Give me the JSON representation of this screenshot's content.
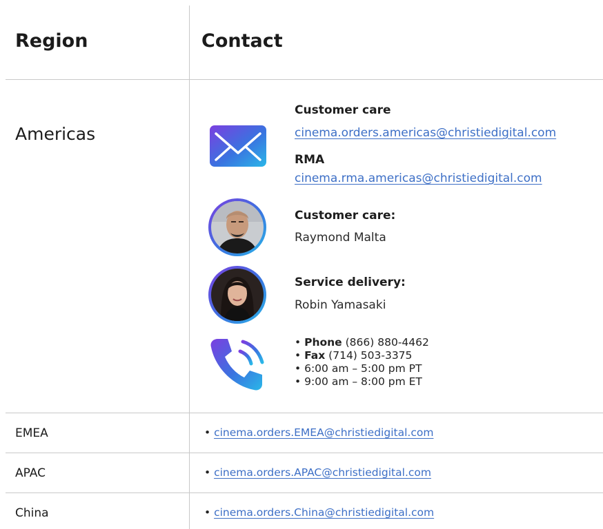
{
  "header": {
    "region_label": "Region",
    "contact_label": "Contact"
  },
  "americas": {
    "region": "Americas",
    "customer_care_label": "Customer care",
    "customer_care_email": "cinema.orders.americas@christiedigital.com",
    "rma_label": "RMA",
    "rma_email": "cinema.rma.americas@christiedigital.com",
    "person1": {
      "role": "Customer care:",
      "name": "Raymond Malta"
    },
    "person2": {
      "role": "Service delivery:",
      "name": "Robin Yamasaki"
    },
    "phone": {
      "bullet": "•",
      "phone_label": "Phone",
      "phone_number": "(866) 880-4462",
      "fax_label": "Fax",
      "fax_number": "(714) 503-3375",
      "hours_pt": "6:00 am – 5:00 pm PT",
      "hours_et": "9:00 am – 8:00 pm ET"
    }
  },
  "rows": [
    {
      "region": "EMEA",
      "bullet": "•",
      "email": "cinema.orders.EMEA@christiedigital.com"
    },
    {
      "region": "APAC",
      "bullet": "•",
      "email": "cinema.orders.APAC@christiedigital.com"
    },
    {
      "region": "China",
      "bullet": "•",
      "email": "cinema.orders.China@christiedigital.com"
    }
  ],
  "icons": {
    "email": "envelope-icon",
    "phone": "phone-icon",
    "person1": "avatar-raymond",
    "person2": "avatar-robin"
  },
  "colors": {
    "link": "#3d6fc6",
    "divider": "#c8c8c8",
    "gradient_start": "#7b3fe0",
    "gradient_end": "#2ab7e8"
  }
}
